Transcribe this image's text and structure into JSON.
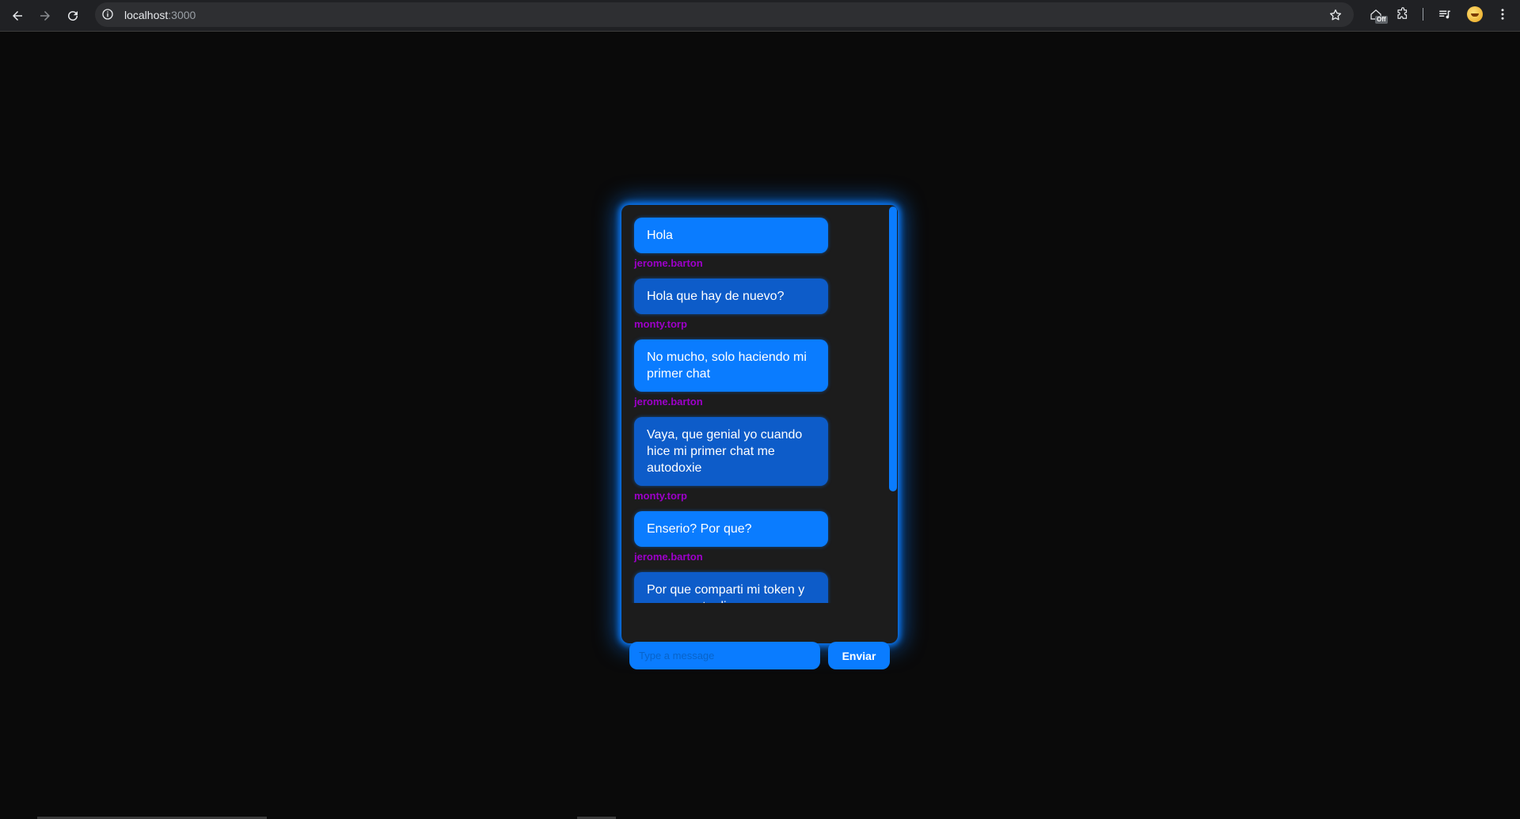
{
  "browser": {
    "url_host": "localhost",
    "url_port": ":3000",
    "off_badge": "Off"
  },
  "chat": {
    "messages": [
      {
        "text": "Hola",
        "user": "jerome.barton"
      },
      {
        "text": "Hola que hay de nuevo?",
        "user": "monty.torp"
      },
      {
        "text": "No mucho, solo haciendo mi primer chat",
        "user": "jerome.barton"
      },
      {
        "text": "Vaya, que genial yo cuando hice mi primer chat me autodoxie",
        "user": "monty.torp"
      },
      {
        "text": "Enserio? Por que?",
        "user": "jerome.barton"
      },
      {
        "text": "Por que comparti mi token y pues que te digo",
        "user": ""
      }
    ],
    "input_placeholder": "Type a message",
    "input_value": "",
    "send_label": "Enviar"
  },
  "colors": {
    "accent": "#0a7cff",
    "bubble_alt": "#0d5cc9",
    "username": "#9d00c9",
    "card_bg": "#1c1c1c",
    "page_bg": "#0a0a0a"
  }
}
